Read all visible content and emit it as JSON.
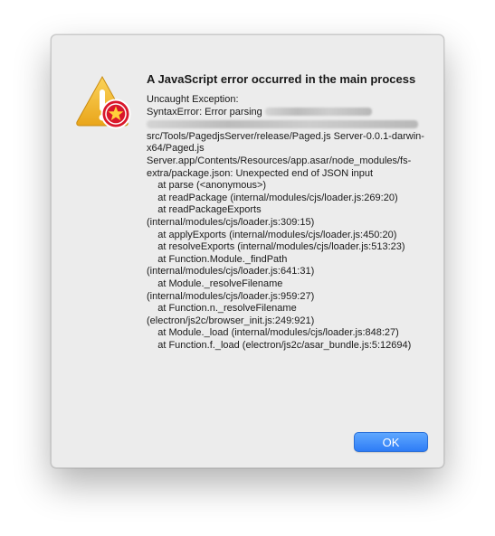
{
  "dialog": {
    "title": "A JavaScript error occurred in the main process",
    "lines": {
      "l1": "Uncaught Exception:",
      "l2": "SyntaxError: Error parsing",
      "l3": "src/Tools/PagedjsServer/release/Paged.js Server-0.0.1-darwin-x64/Paged.js Server.app/Contents/Resources/app.asar/node_modules/fs-extra/package.json: Unexpected end of JSON input",
      "l4": "    at parse (<anonymous>)",
      "l5": "    at readPackage (internal/modules/cjs/loader.js:269:20)",
      "l6": "    at readPackageExports (internal/modules/cjs/loader.js:309:15)",
      "l7": "    at applyExports (internal/modules/cjs/loader.js:450:20)",
      "l8": "    at resolveExports (internal/modules/cjs/loader.js:513:23)",
      "l9": "    at Function.Module._findPath (internal/modules/cjs/loader.js:641:31)",
      "l10": "    at Module._resolveFilename (internal/modules/cjs/loader.js:959:27)",
      "l11": "    at Function.n._resolveFilename (electron/js2c/browser_init.js:249:921)",
      "l12": "    at Module._load (internal/modules/cjs/loader.js:848:27)",
      "l13": "    at Function.f._load (electron/js2c/asar_bundle.js:5:12694)"
    },
    "ok_label": "OK"
  },
  "icons": {
    "warning": "warning-triangle-icon",
    "badge": "app-badge-icon"
  },
  "colors": {
    "warning_yellow": "#f2b52a",
    "badge_red": "#d9172b",
    "button_blue": "#3b87f8"
  }
}
